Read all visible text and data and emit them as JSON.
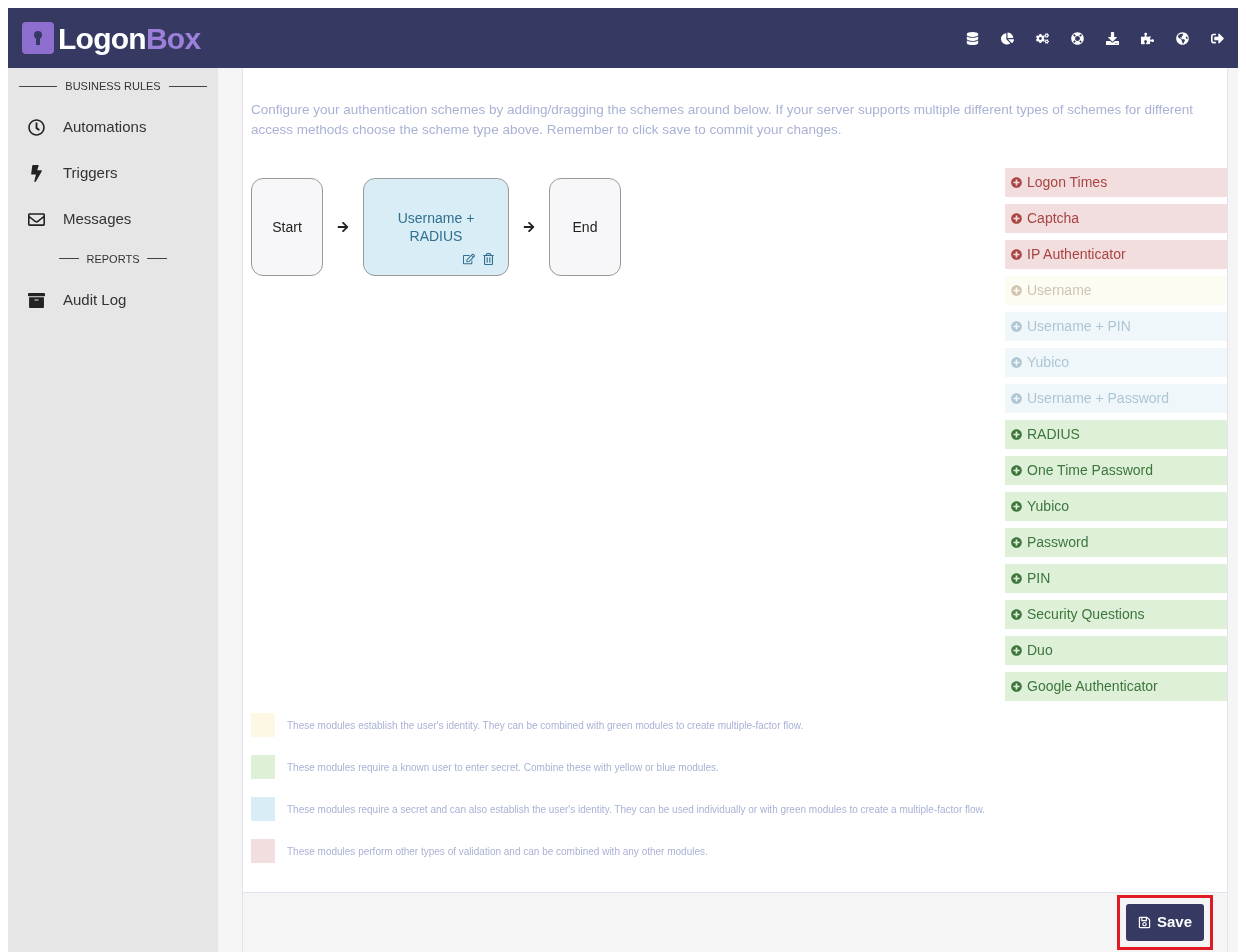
{
  "header": {
    "logo_main": "Logon",
    "logo_accent": "Box"
  },
  "sidebar": {
    "sections": [
      {
        "heading": "BUSINESS RULES",
        "items": [
          {
            "label": "Automations",
            "kind": "clock"
          },
          {
            "label": "Triggers",
            "kind": "bolt"
          },
          {
            "label": "Messages",
            "kind": "envelope"
          }
        ]
      },
      {
        "heading": "REPORTS",
        "items": [
          {
            "label": "Audit Log",
            "kind": "archive"
          }
        ]
      }
    ]
  },
  "intro": "Configure your authentication schemes by adding/dragging the schemes around below. If your server supports multiple different types of schemes for different access methods choose the scheme type above. Remember to click save to commit your changes.",
  "flow": [
    {
      "kind": "terminal",
      "label": "Start"
    },
    {
      "kind": "scheme",
      "label": "Username + RADIUS"
    },
    {
      "kind": "terminal",
      "label": "End"
    }
  ],
  "modules": [
    {
      "label": "Logon Times",
      "kind": "other",
      "disabled": false
    },
    {
      "label": "Captcha",
      "kind": "other",
      "disabled": false
    },
    {
      "label": "IP Authenticator",
      "kind": "other",
      "disabled": false
    },
    {
      "label": "Username",
      "kind": "identity",
      "disabled": true
    },
    {
      "label": "Username + PIN",
      "kind": "both",
      "disabled": true
    },
    {
      "label": "Yubico",
      "kind": "both",
      "disabled": true
    },
    {
      "label": "Username + Password",
      "kind": "both",
      "disabled": true
    },
    {
      "label": "RADIUS",
      "kind": "secret",
      "disabled": false
    },
    {
      "label": "One Time Password",
      "kind": "secret",
      "disabled": false
    },
    {
      "label": "Yubico",
      "kind": "secret",
      "disabled": false
    },
    {
      "label": "Password",
      "kind": "secret",
      "disabled": false
    },
    {
      "label": "PIN",
      "kind": "secret",
      "disabled": false
    },
    {
      "label": "Security Questions",
      "kind": "secret",
      "disabled": false
    },
    {
      "label": "Duo",
      "kind": "secret",
      "disabled": false
    },
    {
      "label": "Google Authenticator",
      "kind": "secret",
      "disabled": false
    }
  ],
  "legend": [
    {
      "kind": "identity",
      "text": "These modules establish the user's identity. They can be combined with green modules to create multiple-factor flow."
    },
    {
      "kind": "secret",
      "text": "These modules require a known user to enter secret. Combine these with yellow or blue modules."
    },
    {
      "kind": "both",
      "text": "These modules require a secret and can also establish the user's identity. They can be used individually or with green modules to create a multiple-factor flow."
    },
    {
      "kind": "other",
      "text": "These modules perform other types of validation and can be combined with any other modules."
    }
  ],
  "save_button": {
    "label": "Save",
    "highlighted": true
  }
}
